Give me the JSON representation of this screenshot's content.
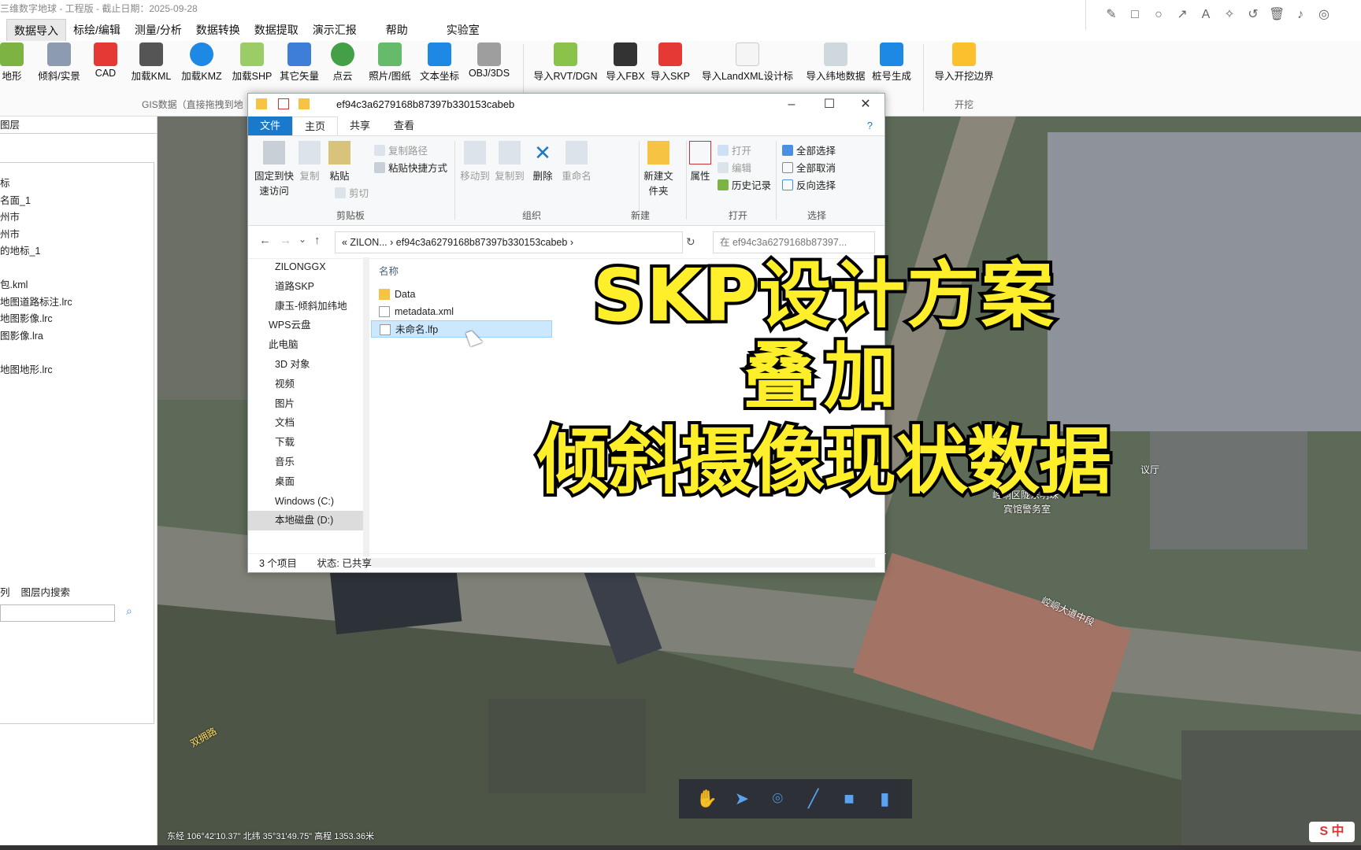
{
  "window_title": "三维数字地球 - 工程版 - 截止日期：2025-09-28",
  "menu": [
    "数据导入",
    "标绘/编辑",
    "测量/分析",
    "数据转换",
    "数据提取",
    "演示汇报",
    "帮助",
    "实验室"
  ],
  "active_menu_index": 0,
  "ribbon": {
    "gis_buttons": [
      "地形",
      "倾斜/实景",
      "CAD",
      "加载KML",
      "加载KMZ",
      "加载SHP",
      "其它矢量",
      "点云",
      "照片/图纸",
      "文本坐标",
      "OBJ/3DS"
    ],
    "design_buttons": [
      "导入RVT/DGN",
      "导入FBX",
      "导入SKP",
      "导入LandXML设计标",
      "导入纬地数据",
      "桩号生成"
    ],
    "excavation_buttons": [
      "导入开挖边界"
    ],
    "group_gis_label": "GIS数据（直接拖拽到地",
    "group_excavation_label": "开挖"
  },
  "left_panel": {
    "header": "图层",
    "tree_items": [
      "标",
      "名面_1",
      "州市",
      "州市",
      "的地标_1",
      "",
      "包.kml",
      "地图道路标注.lrc",
      "地图影像.lrc",
      "图影像.lra",
      "",
      "地图地形.lrc"
    ],
    "bottom_tabs": [
      "列",
      "图层内搜索"
    ],
    "search_placeholder": ""
  },
  "explorer": {
    "title": "ef94c3a6279168b87397b330153cabeb",
    "tabs": [
      "文件",
      "主页",
      "共享",
      "查看"
    ],
    "ribbon": {
      "pin_label": "固定到快速访问",
      "copy_label": "复制",
      "paste_label": "粘贴",
      "copy_path": "复制路径",
      "paste_shortcut": "粘贴快捷方式",
      "cut_label": "剪切",
      "move_to": "移动到",
      "copy_to": "复制到",
      "delete_label": "删除",
      "rename_label": "重命名",
      "new_folder": "新建文件夹",
      "properties": "属性",
      "open_label": "打开",
      "edit_label": "编辑",
      "history_label": "历史记录",
      "select_all": "全部选择",
      "select_none": "全部取消",
      "invert_selection": "反向选择",
      "groups": [
        "剪贴板",
        "组织",
        "新建",
        "打开",
        "选择"
      ]
    },
    "address": "«  ZILON...  ›  ef94c3a6279168b87397b330153cabeb  ›",
    "search_placeholder": "在 ef94c3a6279168b87397...",
    "nav_items": [
      "ZILONGGX",
      "道路SKP",
      "康玉-倾斜加纬地",
      "WPS云盘",
      "此电脑",
      "3D 对象",
      "视频",
      "图片",
      "文档",
      "下载",
      "音乐",
      "桌面",
      "Windows (C:)",
      "本地磁盘 (D:)"
    ],
    "column_name": "名称",
    "files": [
      {
        "name": "Data",
        "type": ""
      },
      {
        "name": "metadata.xml",
        "type": "XML"
      },
      {
        "name": "未命名.lfp",
        "type": "LFP"
      }
    ],
    "status_count": "3 个项目",
    "status_share": "状态: 已共享"
  },
  "overlay": {
    "line1": "SKP设计方案",
    "line2": "叠加",
    "line3": "倾斜摄像现状数据"
  },
  "map": {
    "coords": "东经 106°42'10.37\" 北纬 35°31'49.75\" 高程 1353.36米",
    "labels": [
      "崆峒区陇东明珠",
      "宾馆警务室",
      "议厅",
      "崆峒大道中段",
      "双拥路"
    ]
  },
  "colors": {
    "overlay_text": "#ffef2b",
    "accent": "#1979ca"
  }
}
